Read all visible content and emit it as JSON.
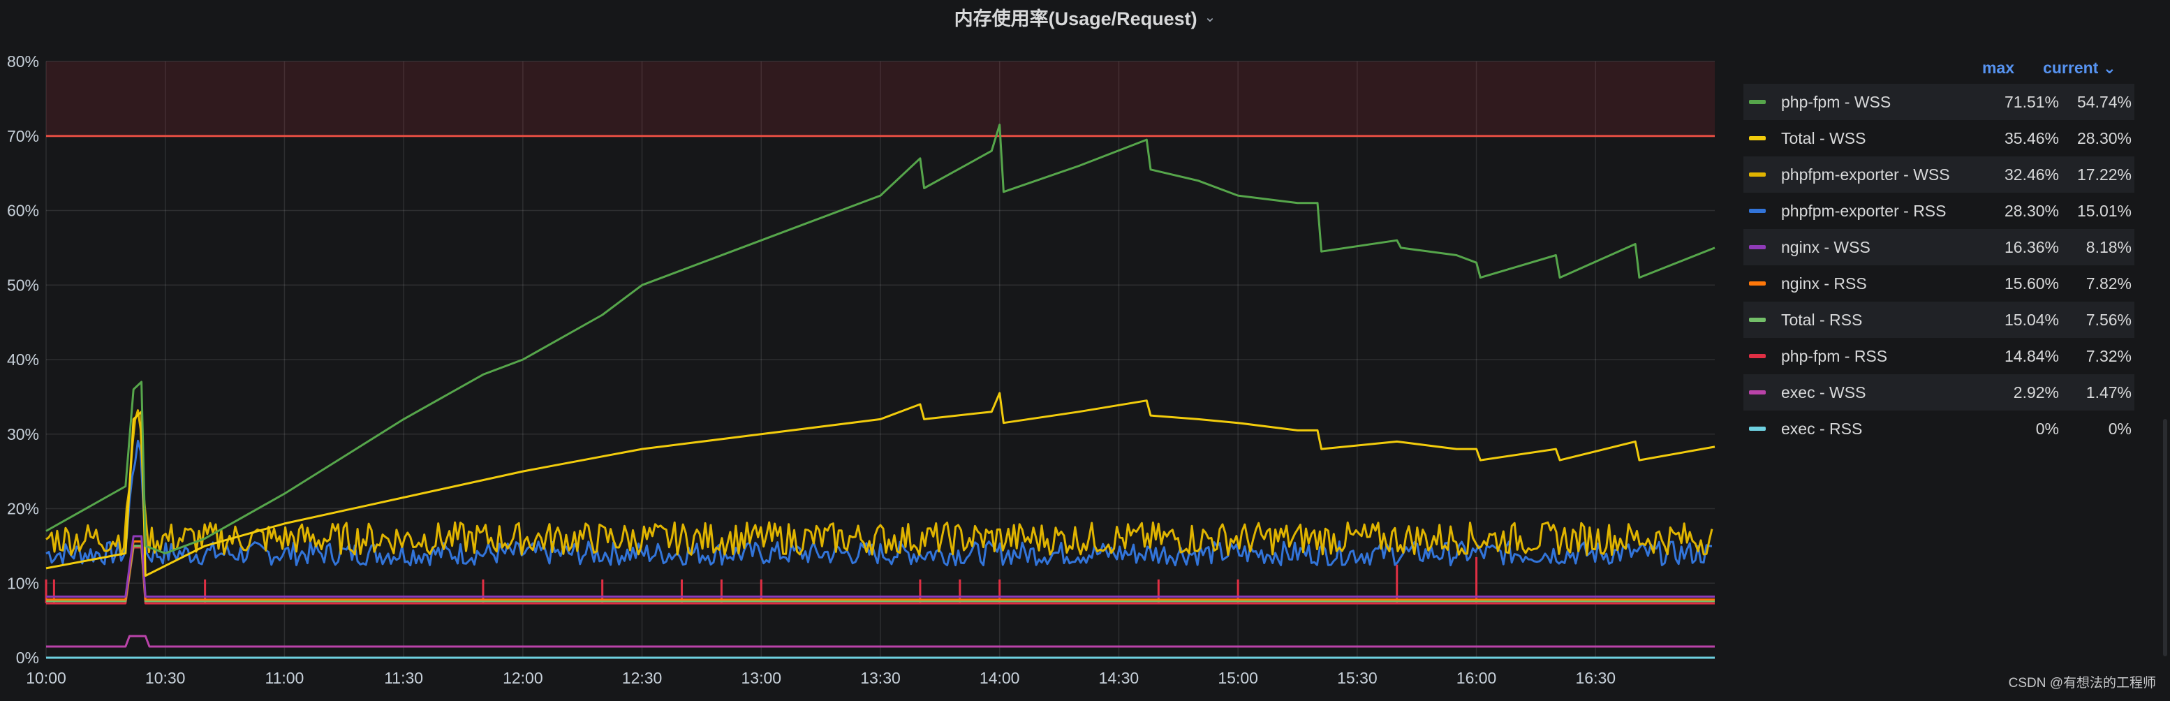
{
  "panel": {
    "title": "内存使用率(Usage/Request)",
    "watermark": "CSDN @有想法的工程师"
  },
  "legend": {
    "header_max": "max",
    "header_current": "current",
    "rows": [
      {
        "name": "php-fpm - WSS",
        "max": "71.51%",
        "current": "54.74%",
        "color": "#56a64b"
      },
      {
        "name": "Total - WSS",
        "max": "35.46%",
        "current": "28.30%",
        "color": "#f2cc0c"
      },
      {
        "name": "phpfpm-exporter - WSS",
        "max": "32.46%",
        "current": "17.22%",
        "color": "#e0b400"
      },
      {
        "name": "phpfpm-exporter - RSS",
        "max": "28.30%",
        "current": "15.01%",
        "color": "#3274d9"
      },
      {
        "name": "nginx - WSS",
        "max": "16.36%",
        "current": "8.18%",
        "color": "#8f3bb8"
      },
      {
        "name": "nginx - RSS",
        "max": "15.60%",
        "current": "7.82%",
        "color": "#ff780a"
      },
      {
        "name": "Total - RSS",
        "max": "15.04%",
        "current": "7.56%",
        "color": "#73bf69"
      },
      {
        "name": "php-fpm - RSS",
        "max": "14.84%",
        "current": "7.32%",
        "color": "#e02f44"
      },
      {
        "name": "exec - WSS",
        "max": "2.92%",
        "current": "1.47%",
        "color": "#ba43a9"
      },
      {
        "name": "exec - RSS",
        "max": "0%",
        "current": "0%",
        "color": "#6ed0e0"
      }
    ]
  },
  "chart_data": {
    "type": "line",
    "title": "内存使用率(Usage/Request)",
    "xlabel": "",
    "ylabel": "",
    "x_range": [
      "10:00",
      "17:00"
    ],
    "xticks": [
      "10:00",
      "10:30",
      "11:00",
      "11:30",
      "12:00",
      "12:30",
      "13:00",
      "13:30",
      "14:00",
      "14:30",
      "15:00",
      "15:30",
      "16:00",
      "16:30"
    ],
    "ylim": [
      0,
      80
    ],
    "yticks": [
      "0%",
      "10%",
      "20%",
      "30%",
      "40%",
      "50%",
      "60%",
      "70%",
      "80%"
    ],
    "threshold": {
      "value": 70,
      "color": "#e24d42",
      "fill": "above"
    },
    "grid": true,
    "legend_position": "right",
    "series": [
      {
        "name": "php-fpm - WSS",
        "color": "#56a64b",
        "x": [
          "10:00",
          "10:20",
          "10:22",
          "10:24",
          "10:25",
          "10:30",
          "10:40",
          "11:00",
          "11:30",
          "11:50",
          "12:00",
          "12:20",
          "12:30",
          "13:00",
          "13:30",
          "13:40",
          "13:41",
          "13:58",
          "14:00",
          "14:01",
          "14:20",
          "14:37",
          "14:38",
          "14:50",
          "15:00",
          "15:15",
          "15:20",
          "15:21",
          "15:40",
          "15:41",
          "15:55",
          "16:00",
          "16:01",
          "16:20",
          "16:21",
          "16:40",
          "16:41",
          "17:00"
        ],
        "y": [
          17,
          23,
          36,
          37,
          15,
          14,
          16,
          22,
          32,
          38,
          40,
          46,
          50,
          56,
          62,
          67,
          63,
          68,
          71.5,
          62.5,
          66,
          69.5,
          65.5,
          64,
          62,
          61,
          61,
          54.5,
          56,
          55,
          54,
          53,
          51,
          54,
          51,
          55.5,
          51,
          55
        ]
      },
      {
        "name": "Total - WSS",
        "color": "#f2cc0c",
        "x": [
          "10:00",
          "10:20",
          "10:22",
          "10:24",
          "10:25",
          "10:40",
          "11:00",
          "11:30",
          "12:00",
          "12:30",
          "13:00",
          "13:30",
          "13:40",
          "13:41",
          "13:58",
          "14:00",
          "14:01",
          "14:20",
          "14:37",
          "14:38",
          "14:50",
          "15:00",
          "15:15",
          "15:20",
          "15:21",
          "15:40",
          "15:55",
          "16:00",
          "16:01",
          "16:20",
          "16:21",
          "16:40",
          "16:41",
          "17:00"
        ],
        "y": [
          12,
          14,
          32,
          33,
          11,
          15,
          18,
          21.5,
          25,
          28,
          30,
          32,
          34,
          32,
          33,
          35.5,
          31.5,
          33,
          34.5,
          32.5,
          32,
          31.5,
          30.5,
          30.5,
          28,
          29,
          28,
          28,
          26.5,
          28,
          26.5,
          29,
          26.5,
          28.3
        ]
      },
      {
        "name": "phpfpm-exporter - WSS",
        "color": "#e0b400",
        "x": [
          "10:00",
          "10:20",
          "10:22",
          "10:24",
          "10:25",
          "11:00",
          "12:00",
          "13:00",
          "14:00",
          "15:00",
          "16:00",
          "17:00"
        ],
        "y": [
          16,
          16,
          31,
          32,
          16,
          16,
          16,
          16,
          16,
          16,
          16,
          16
        ],
        "noise": 2.2
      },
      {
        "name": "phpfpm-exporter - RSS",
        "color": "#3274d9",
        "x": [
          "10:00",
          "10:20",
          "10:22",
          "10:24",
          "10:25",
          "11:00",
          "12:00",
          "13:00",
          "14:00",
          "15:00",
          "16:00",
          "17:00"
        ],
        "y": [
          14,
          14,
          27,
          28,
          14,
          14,
          14,
          14,
          14,
          14,
          14,
          14
        ],
        "noise": 1.6
      },
      {
        "name": "nginx - WSS",
        "color": "#8f3bb8",
        "x": [
          "10:00",
          "10:20",
          "10:22",
          "10:24",
          "10:25",
          "17:00"
        ],
        "y": [
          8.2,
          8.2,
          16.3,
          16.3,
          8.2,
          8.2
        ]
      },
      {
        "name": "nginx - RSS",
        "color": "#ff780a",
        "x": [
          "10:00",
          "10:20",
          "10:22",
          "10:24",
          "10:25",
          "17:00"
        ],
        "y": [
          7.8,
          7.8,
          15.6,
          15.6,
          7.8,
          7.8
        ]
      },
      {
        "name": "Total - RSS",
        "color": "#73bf69",
        "x": [
          "10:00",
          "10:20",
          "10:22",
          "10:24",
          "10:25",
          "17:00"
        ],
        "y": [
          7.6,
          7.6,
          15,
          15,
          7.6,
          7.6
        ]
      },
      {
        "name": "php-fpm - RSS",
        "color": "#e02f44",
        "x": [
          "10:00",
          "10:20",
          "10:22",
          "10:24",
          "10:25",
          "17:00"
        ],
        "y": [
          7.3,
          7.3,
          14.8,
          14.8,
          7.3,
          7.3
        ],
        "spikes": [
          {
            "x": "10:00",
            "y": 10.5
          },
          {
            "x": "10:02",
            "y": 10.5
          },
          {
            "x": "10:40",
            "y": 10.5
          },
          {
            "x": "11:50",
            "y": 10.5
          },
          {
            "x": "12:20",
            "y": 10.5
          },
          {
            "x": "12:40",
            "y": 10.5
          },
          {
            "x": "12:50",
            "y": 10.5
          },
          {
            "x": "13:00",
            "y": 10.5
          },
          {
            "x": "13:40",
            "y": 10.5
          },
          {
            "x": "13:50",
            "y": 10.5
          },
          {
            "x": "14:00",
            "y": 10.5
          },
          {
            "x": "14:40",
            "y": 10.5
          },
          {
            "x": "15:00",
            "y": 10.5
          },
          {
            "x": "15:40",
            "y": 12.5
          },
          {
            "x": "16:00",
            "y": 13.5
          }
        ]
      },
      {
        "name": "exec - WSS",
        "color": "#ba43a9",
        "x": [
          "10:00",
          "10:20",
          "10:21",
          "10:25",
          "10:26",
          "17:00"
        ],
        "y": [
          1.5,
          1.5,
          2.9,
          2.9,
          1.5,
          1.5
        ]
      },
      {
        "name": "exec - RSS",
        "color": "#6ed0e0",
        "x": [
          "10:00",
          "17:00"
        ],
        "y": [
          0,
          0
        ]
      }
    ]
  }
}
